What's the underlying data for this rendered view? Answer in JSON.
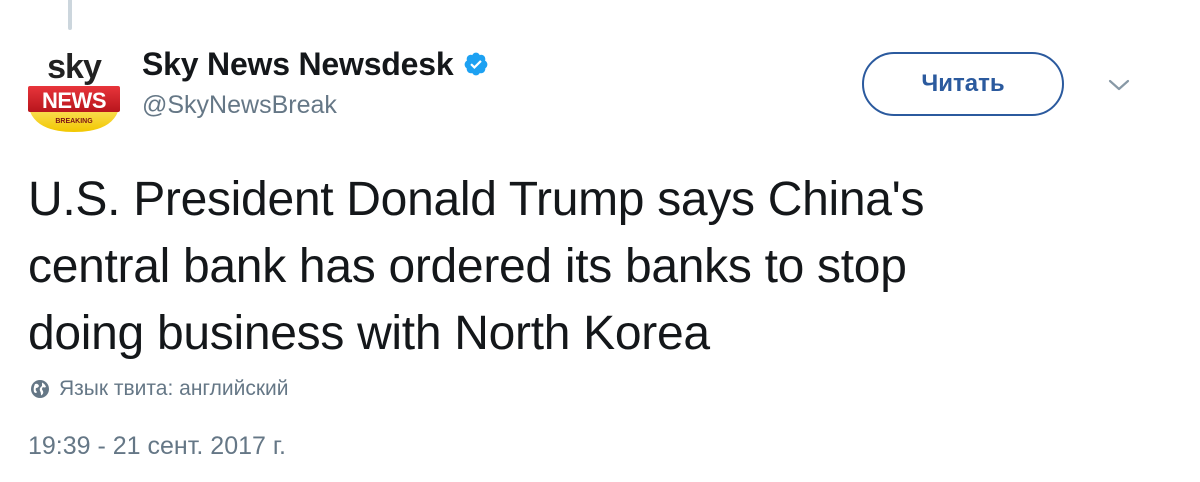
{
  "tweet": {
    "author": {
      "display_name": "Sky News Newsdesk",
      "handle": "@SkyNewsBreak",
      "verified": true,
      "avatar": {
        "logo_top": "sky",
        "logo_middle": "NEWS",
        "logo_bottom": "BREAKING"
      }
    },
    "follow_button_label": "Читать",
    "menu_icon": "chevron-down-icon",
    "text_lines": [
      "U.S. President Donald Trump says China's",
      "central bank has ordered its banks to stop",
      "doing business with North Korea"
    ],
    "language_note": "Язык твита: английский",
    "language_icon": "globe-icon",
    "timestamp": "19:39 - 21 сент. 2017 г."
  },
  "colors": {
    "text_primary": "#14171a",
    "text_secondary": "#657786",
    "button_accent": "#2b5a9e",
    "verified_blue": "#1da1f2",
    "thread_line": "#ccd6dd",
    "sky_red": "#d2232a",
    "sky_yellow": "#f7d417"
  }
}
